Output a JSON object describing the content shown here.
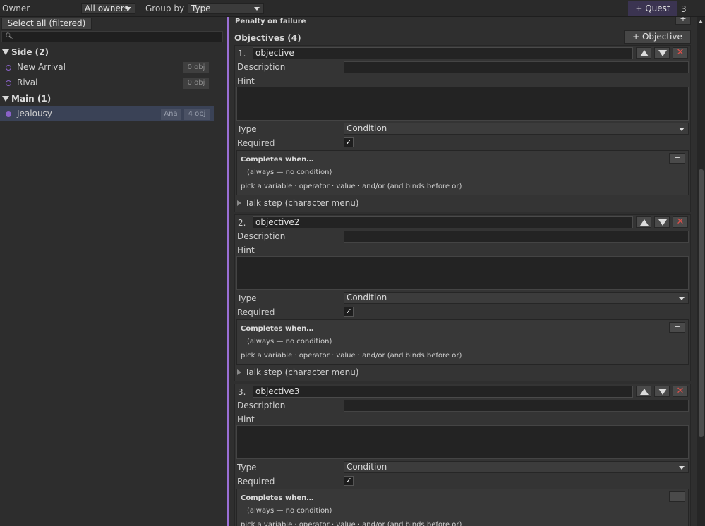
{
  "topbar": {
    "owner_label": "Owner",
    "owner_value": "All owners",
    "groupby_label": "Group by",
    "groupby_value": "Type",
    "add_quest_label": "+ Quest",
    "quest_count": "3"
  },
  "left": {
    "select_all_label": "Select all (filtered)",
    "search_value": "",
    "groups": [
      {
        "label": "Side (2)"
      },
      {
        "label": "Main (1)"
      }
    ],
    "quests": [
      {
        "name": "New Arrival",
        "owner": "",
        "objectives": "0 obj",
        "selected": false
      },
      {
        "name": "Rival",
        "owner": "",
        "objectives": "0 obj",
        "selected": false
      },
      {
        "name": "Jealousy",
        "owner": "Ana",
        "objectives": "4 obj",
        "selected": true
      }
    ]
  },
  "editor": {
    "penalty_label": "Penalty on failure",
    "penalty_add": "+",
    "objectives_header": "Objectives (4)",
    "add_objective_label": "+ Objective",
    "field_labels": {
      "description": "Description",
      "hint": "Hint",
      "type": "Type",
      "required": "Required",
      "completes_when": "Completes when…",
      "no_condition": "(always — no condition)",
      "condition_help": "pick a variable · operator · value · and/or  (and binds before or)",
      "talk_step": "Talk step (character menu)",
      "add_condition": "+",
      "delete": "✕",
      "check": "✓"
    },
    "objectives": [
      {
        "index": "1.",
        "name": "objective",
        "description": "",
        "hint": "",
        "type": "Condition",
        "required": true
      },
      {
        "index": "2.",
        "name": "objective2",
        "description": "",
        "hint": "",
        "type": "Condition",
        "required": true
      },
      {
        "index": "3.",
        "name": "objective3",
        "description": "",
        "hint": "",
        "type": "Condition",
        "required": true
      }
    ]
  },
  "colors": {
    "accent": "#9a6fd6",
    "selection": "#3a4256",
    "delete": "#e0504a"
  },
  "icons": {
    "search": "search-icon",
    "move_up": "arrow-up-icon",
    "move_down": "arrow-down-icon",
    "delete": "close-icon",
    "expand": "triangle-right-icon",
    "collapse": "triangle-down-icon",
    "dropdown": "caret-down-icon"
  }
}
